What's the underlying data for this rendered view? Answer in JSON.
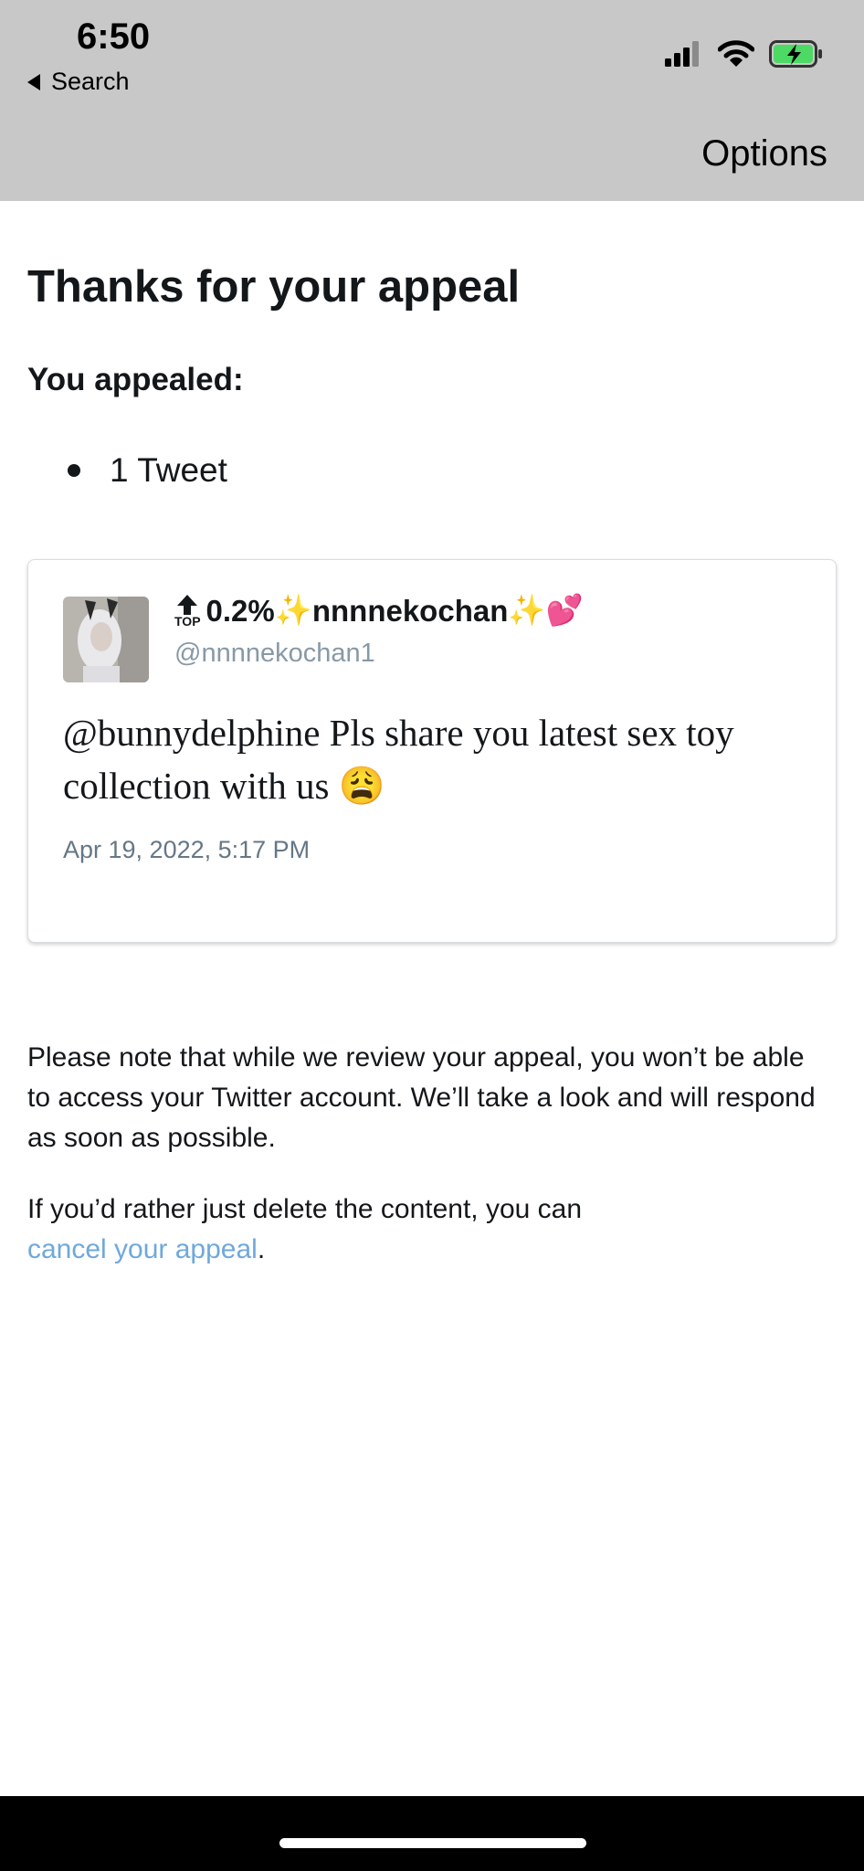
{
  "status_bar": {
    "time": "6:50",
    "back_label": "Search",
    "icons": [
      "signal-icon",
      "wifi-icon",
      "battery-charging-icon"
    ]
  },
  "nav": {
    "options_label": "Options"
  },
  "page": {
    "title": "Thanks for your appeal",
    "subtitle": "You appealed:",
    "items": [
      "1 Tweet"
    ]
  },
  "tweet": {
    "top_label": "TOP",
    "rank": "0.2%",
    "sparkle_left": "✨",
    "display_name": "nnnnekochan",
    "sparkle_right": "✨",
    "heart": "💕",
    "handle": "@nnnnekochan1",
    "text": "@bunnydelphine Pls share you latest sex toy collection with us 😩",
    "date": "Apr 19, 2022, 5:17 PM"
  },
  "notice": {
    "text": "Please note that while we review your appeal, you won’t be able to access your Twitter account. We’ll take a look and will respond as soon as possible.",
    "cancel_prefix": "If you’d rather just delete the content, you can ",
    "cancel_link": "cancel your appeal",
    "cancel_suffix": "."
  },
  "colors": {
    "header_bg": "#c8c8c8",
    "link": "#6fa8dc",
    "handle": "#8899a6",
    "battery": "#4cd964"
  }
}
